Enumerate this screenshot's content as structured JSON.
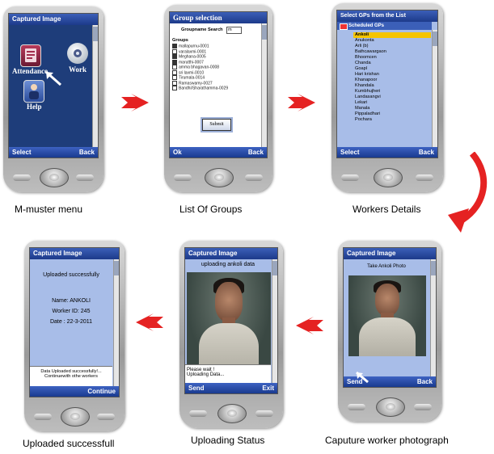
{
  "colors": {
    "arrow": "#e52222",
    "title_bar": "#1d3a8a",
    "screen_blue": "#a8bde8",
    "menu_bg": "#1e3d7a"
  },
  "steps": {
    "mmuster": {
      "caption": "M-muster menu",
      "title": "Captured Image",
      "menu": [
        {
          "label": "Attendance",
          "icon": "attendance-book-icon"
        },
        {
          "label": "Work",
          "icon": "work-disc-icon"
        },
        {
          "label": "Help",
          "icon": "help-person-icon"
        }
      ],
      "soft_left": "Select",
      "soft_right": "Back"
    },
    "groups": {
      "caption": "List Of Groups",
      "title": "Group selection",
      "search_label": "Groupname Search",
      "search_value": "m",
      "groups_label": "Groups",
      "items": [
        {
          "name": "mallapurnu-0001",
          "checked": true
        },
        {
          "name": "varalaxmi-0001",
          "checked": false
        },
        {
          "name": "Meghana-0005",
          "checked": true
        },
        {
          "name": "marutthi-0007",
          "checked": true
        },
        {
          "name": "amma bhagavan-0008",
          "checked": false
        },
        {
          "name": "sri laxmi-0010",
          "checked": false
        },
        {
          "name": "Tirumala-0014",
          "checked": false
        },
        {
          "name": "Ramaswamy-0027",
          "checked": false
        },
        {
          "name": "Bandhi/Sharathamma-0029",
          "checked": false
        }
      ],
      "submit_label": "Submit",
      "soft_left": "Ok",
      "soft_right": "Back"
    },
    "workers": {
      "caption": "Workers Details",
      "title": "Select GPs from the List",
      "section": "Scheduled GPs",
      "items": [
        "Ankoli",
        "Anukonta",
        "Arli (b)",
        "Bathcawargaon",
        "Bhoomcen",
        "Chanda",
        "Goapl",
        "Hari krishan",
        "Khanapoor",
        "Khandala",
        "Kumbhujheri",
        "Landasangvi",
        "Lekari",
        "Manala",
        "Pippaladhari",
        "Pochara"
      ],
      "selected_index": 0,
      "soft_left": "Select",
      "soft_right": "Back"
    },
    "capture": {
      "caption": "Caputure worker photograph",
      "title": "Captured Image",
      "heading": "Take Ankoli Photo",
      "soft_left": "Send",
      "soft_right": "Back"
    },
    "uploading": {
      "caption": "Uploading Status",
      "title": "Captured Image",
      "heading": "uploading ankoli data",
      "status_lines": [
        "Please wait !",
        "Uploading Data..."
      ],
      "soft_left": "Send",
      "soft_right": "Exit"
    },
    "uploaded": {
      "caption": "Uploaded successfull",
      "title": "Captured Image",
      "heading": "Uploaded successfully",
      "name_line": "Name: ANKOLI",
      "id_line": "Worker ID: 245",
      "date_line": "Date : 22-3-2011",
      "footer_lines": [
        "Data Uploaded successfully!...",
        "Continuewith othe workers"
      ],
      "soft_right": "Continue"
    }
  }
}
